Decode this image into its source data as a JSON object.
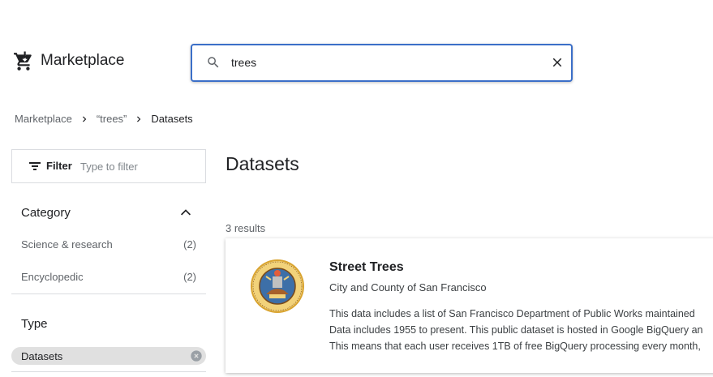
{
  "header": {
    "app_title": "Marketplace",
    "search": {
      "value": "trees"
    }
  },
  "breadcrumb": {
    "items": [
      "Marketplace",
      "“trees”"
    ],
    "current": "Datasets"
  },
  "filter": {
    "label": "Filter",
    "placeholder": "Type to filter"
  },
  "sidebar": {
    "category": {
      "title": "Category",
      "items": [
        {
          "label": "Science & research",
          "count": "(2)"
        },
        {
          "label": "Encyclopedic",
          "count": "(2)"
        }
      ]
    },
    "type": {
      "title": "Type",
      "chip": "Datasets"
    }
  },
  "main": {
    "title": "Datasets",
    "results_count": "3 results",
    "card": {
      "title": "Street Trees",
      "subtitle": "City and County of San Francisco",
      "description_lines": [
        "This data includes a list of San Francisco Department of Public Works maintained",
        "Data includes 1955 to present. This public dataset is hosted in Google BigQuery an",
        "This means that each user receives 1TB of free BigQuery processing every month,"
      ]
    }
  },
  "colors": {
    "accent": "#3b6fc8",
    "text_primary": "#202124",
    "text_secondary": "#5f6368",
    "chip_bg": "#e0e0e0",
    "divider": "#dadce0"
  },
  "icons": {
    "logo": "cart-download-icon",
    "search": "search-icon",
    "clear": "close-icon",
    "filter": "filter-lines-icon",
    "collapse": "chevron-up-icon",
    "chip_remove": "cancel-circle-icon",
    "breadcrumb_sep": "chevron-right-icon"
  }
}
